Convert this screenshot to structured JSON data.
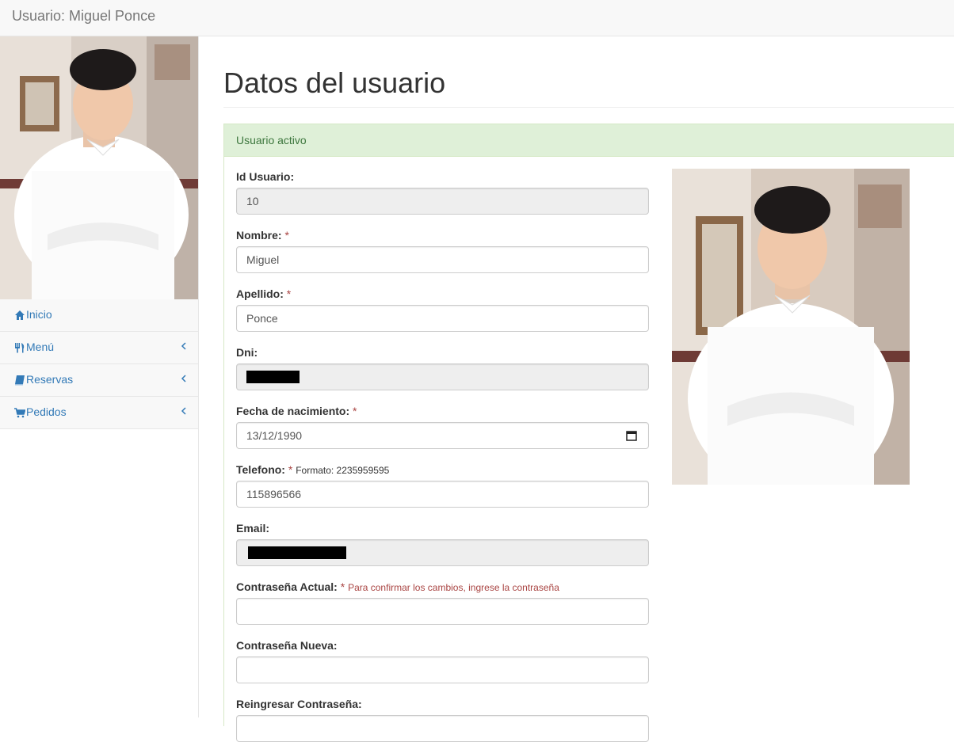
{
  "navbar": {
    "title": "Usuario: Miguel Ponce"
  },
  "sidebar": {
    "items": [
      {
        "label": "Inicio",
        "icon": "home-icon",
        "has_submenu": false
      },
      {
        "label": "Menú",
        "icon": "cutlery-icon",
        "has_submenu": true
      },
      {
        "label": "Reservas",
        "icon": "book-icon",
        "has_submenu": true
      },
      {
        "label": "Pedidos",
        "icon": "cart-icon",
        "has_submenu": true
      }
    ]
  },
  "page": {
    "title": "Datos del usuario"
  },
  "panel": {
    "status": "Usuario activo"
  },
  "form": {
    "id": {
      "label": "Id Usuario:",
      "value": "10"
    },
    "nombre": {
      "label": "Nombre:",
      "required": "*",
      "value": "Miguel"
    },
    "apellido": {
      "label": "Apellido:",
      "required": "*",
      "value": "Ponce"
    },
    "dni": {
      "label": "Dni:"
    },
    "fecha": {
      "label": "Fecha de nacimiento:",
      "required": "*",
      "value": "13/12/1990"
    },
    "telefono": {
      "label": "Telefono:",
      "required": "*",
      "hint": "Formato: 2235959595",
      "value": "115896566"
    },
    "email": {
      "label": "Email:"
    },
    "pass_actual": {
      "label": "Contraseña Actual:",
      "required": "*",
      "hint": "Para confirmar los cambios, ingrese la contraseña",
      "value": ""
    },
    "pass_nueva": {
      "label": "Contraseña Nueva:",
      "value": ""
    },
    "pass_reingreso": {
      "label": "Reingresar Contraseña:"
    }
  },
  "colors": {
    "link": "#337ab7",
    "success_bg": "#dff0d8",
    "success_text": "#3c763d",
    "required": "#a94442"
  }
}
